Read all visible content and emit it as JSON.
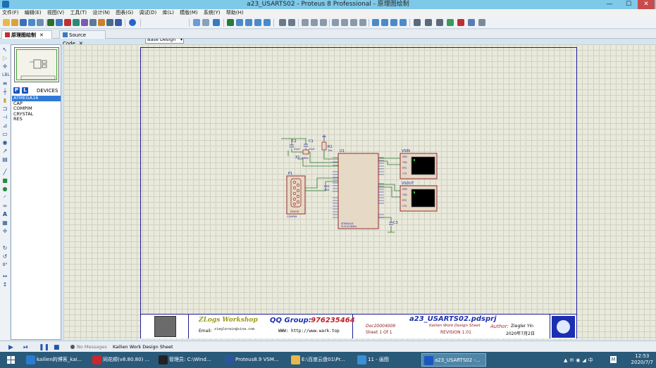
{
  "window": {
    "title": "a23_USARTS02 - Proteus 8 Professional - 原理图绘制",
    "min": "—",
    "max": "☐",
    "close": "✕"
  },
  "menu": [
    "文件(F)",
    "编辑(E)",
    "视图(V)",
    "工具(T)",
    "设计(N)",
    "图表(G)",
    "调试(D)",
    "库(L)",
    "模版(M)",
    "系统(Y)",
    "帮助(H)"
  ],
  "toolbar": {
    "design_select": "Base Design"
  },
  "tabs": [
    {
      "label": "原理图绘制",
      "close": "✕",
      "active": true
    },
    {
      "label": "Source Code",
      "close": "✕",
      "active": false
    }
  ],
  "panel": {
    "btn_p": "P",
    "btn_l": "L",
    "title": "DEVICES",
    "devices": [
      "ATMEGA16",
      "CAP",
      "COMPIM",
      "CRYSTAL",
      "RES"
    ],
    "selected": "ATMEGA16"
  },
  "left_tools": {
    "angle": "0°"
  },
  "schematic": {
    "C2": "C2",
    "C2v": "22pF",
    "C1": "C1",
    "C1v": "22pF",
    "R1": "R1",
    "R1v": "10k",
    "X1": "X1",
    "X1v": "8MHz",
    "U1": "U1",
    "P1": "P1",
    "p1_err": "ERROR",
    "p1_part": "COMPIM",
    "vsin": "VSIN",
    "vsout": "VSOUT",
    "C3": "C3",
    "rx": "RXD",
    "tx": "TXD",
    "u1_part": "ATMEGA16",
    "u1_sub": "CLOCK=8MHz",
    "vt_pins": [
      "RXD",
      "TXD",
      "RTS",
      "CTS"
    ]
  },
  "titleblock": {
    "zlogo": "ZLogs Workshop",
    "qq_label": "QQ Group:",
    "qq_num": "976235464",
    "email_label": "Email:",
    "email": "zieglerwin@sina.com",
    "www": "WWW: http://www.wark.top",
    "doc": "Doc20004009",
    "sheet_label": "Sheet",
    "sheet_no": "1",
    "of_label": "Of",
    "of_no": "1",
    "proj": "a23_USARTS02.pdsprj",
    "subtitle": "Kailien Work Design Sheet",
    "revision": "REVISION 1.01",
    "author_label": "Author:",
    "author": "Ziegler Yin",
    "date": "2020年7月2日"
  },
  "status": {
    "messages": "No Messages",
    "sheet": "Kailien Work Design Sheet"
  },
  "taskbar": [
    {
      "label": "kailien的博客_kai...",
      "color": "#2b7bd1"
    },
    {
      "label": "同花顺(v8.80.80) ...",
      "color": "#c8272d"
    },
    {
      "label": "管理员: C:\\Wind...",
      "color": "#222222"
    },
    {
      "label": "Proteus8.9 VSM...",
      "color": "#2b579a"
    },
    {
      "label": "E:\\百度云盘01\\Pr...",
      "color": "#e7b84a"
    },
    {
      "label": "11 - 画图",
      "color": "#3a8fd6"
    },
    {
      "label": "a23_USARTS02 -...",
      "color": "#1a56c4"
    }
  ],
  "clock": {
    "time": "12:53",
    "date": "2020/7/7"
  },
  "colors": {
    "sheet_border": "#1c1c9a",
    "component": "#8b1a1a",
    "wire": "#2f7a2f",
    "part_fill": "#e6d9c6",
    "pin": "#1c1c9a",
    "selection": "#2e7ad8"
  }
}
